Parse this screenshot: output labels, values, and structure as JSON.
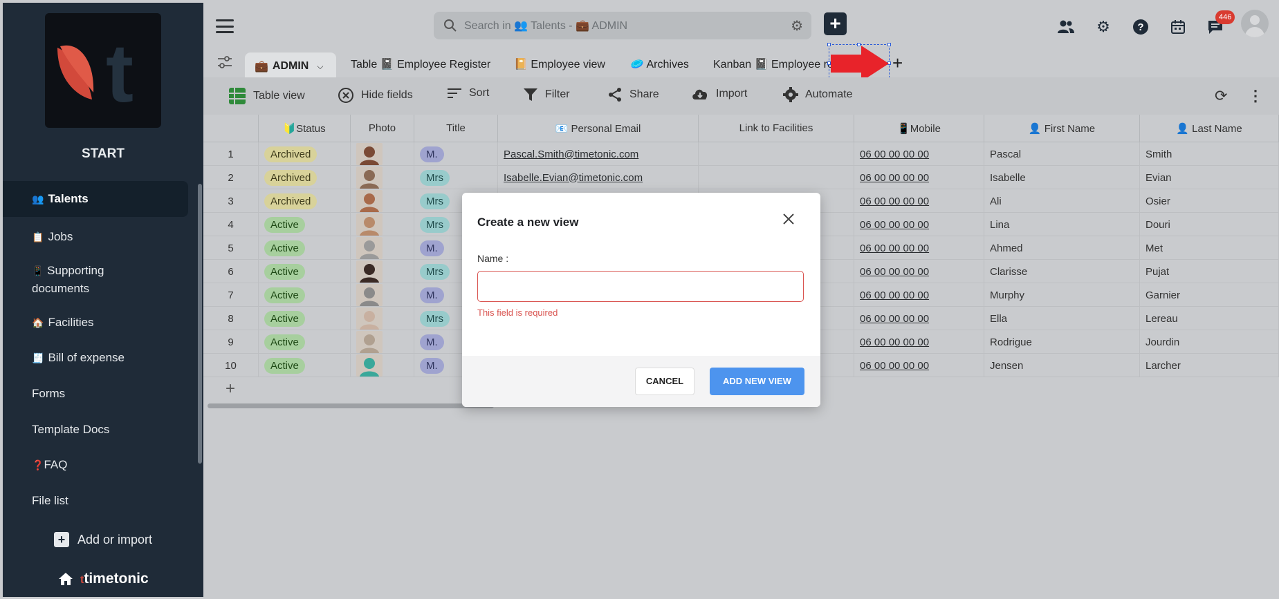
{
  "app": {
    "start_label": "START",
    "brand_name": "timetonic",
    "brand_mark": "t"
  },
  "sidebar": {
    "items": [
      {
        "icon": "👥",
        "label": "Talents",
        "active": true
      },
      {
        "icon": "📋",
        "label": "Jobs"
      },
      {
        "icon": "📱",
        "label": "Supporting documents"
      },
      {
        "icon": "🏠",
        "label": "Facilities"
      },
      {
        "icon": "🧾",
        "label": "Bill of expense"
      },
      {
        "icon": "",
        "label": "Forms"
      },
      {
        "icon": "",
        "label": "Template Docs"
      },
      {
        "icon": "❓",
        "label": "FAQ"
      },
      {
        "icon": "",
        "label": "File list"
      }
    ],
    "add_import_label": "Add or import"
  },
  "topbar": {
    "search_placeholder": "Search in 👥 Talents - 💼 ADMIN",
    "notifications_count": "446"
  },
  "tabs": {
    "active": "ADMIN",
    "items": [
      "Table 📓 Employee Register",
      "📔 Employee view",
      "🥏 Archives",
      "Kanban 📓 Employee re"
    ]
  },
  "toolbar": {
    "table_view": "Table view",
    "hide_fields": "Hide fields",
    "sort": "Sort",
    "filter": "Filter",
    "share": "Share",
    "import": "Import",
    "automate": "Automate"
  },
  "table": {
    "columns": [
      "",
      "🔰Status",
      "Photo",
      "Title",
      "📧 Personal Email",
      "Link to Facilities",
      "📱Mobile",
      "👤 First Name",
      "👤 Last Name"
    ],
    "rows": [
      {
        "n": "1",
        "status": "Archived",
        "title": "M.",
        "email": "Pascal.Smith@timetonic.com",
        "mobile": "06 00 00 00 00",
        "first": "Pascal",
        "last": "Smith"
      },
      {
        "n": "2",
        "status": "Archived",
        "title": "Mrs",
        "email": "Isabelle.Evian@timetonic.com",
        "mobile": "06 00 00 00 00",
        "first": "Isabelle",
        "last": "Evian"
      },
      {
        "n": "3",
        "status": "Archived",
        "title": "Mrs",
        "email": "",
        "mobile": "06 00 00 00 00",
        "first": "Ali",
        "last": "Osier"
      },
      {
        "n": "4",
        "status": "Active",
        "title": "Mrs",
        "email": "",
        "mobile": "06 00 00 00 00",
        "first": "Lina",
        "last": "Douri"
      },
      {
        "n": "5",
        "status": "Active",
        "title": "M.",
        "email": "",
        "mobile": "06 00 00 00 00",
        "first": "Ahmed",
        "last": "Met"
      },
      {
        "n": "6",
        "status": "Active",
        "title": "Mrs",
        "email": "",
        "mobile": "06 00 00 00 00",
        "first": "Clarisse",
        "last": "Pujat"
      },
      {
        "n": "7",
        "status": "Active",
        "title": "M.",
        "email": "",
        "mobile": "06 00 00 00 00",
        "first": "Murphy",
        "last": "Garnier"
      },
      {
        "n": "8",
        "status": "Active",
        "title": "Mrs",
        "email": "",
        "mobile": "06 00 00 00 00",
        "first": "Ella",
        "last": "Lereau"
      },
      {
        "n": "9",
        "status": "Active",
        "title": "M.",
        "email": "",
        "mobile": "06 00 00 00 00",
        "first": "Rodrigue",
        "last": "Jourdin"
      },
      {
        "n": "10",
        "status": "Active",
        "title": "M.",
        "email": "",
        "mobile": "06 00 00 00 00",
        "first": "Jensen",
        "last": "Larcher"
      }
    ],
    "add_row": "+"
  },
  "modal": {
    "title": "Create a new view",
    "name_label": "Name :",
    "name_value": "",
    "error": "This field is required",
    "cancel": "CANCEL",
    "add": "ADD NEW VIEW"
  },
  "colors": {
    "sidebar_bg": "#1f2b38",
    "accent_blue": "#4d94ee",
    "error_red": "#d9534f",
    "annotation_arrow": "#e8232a"
  }
}
